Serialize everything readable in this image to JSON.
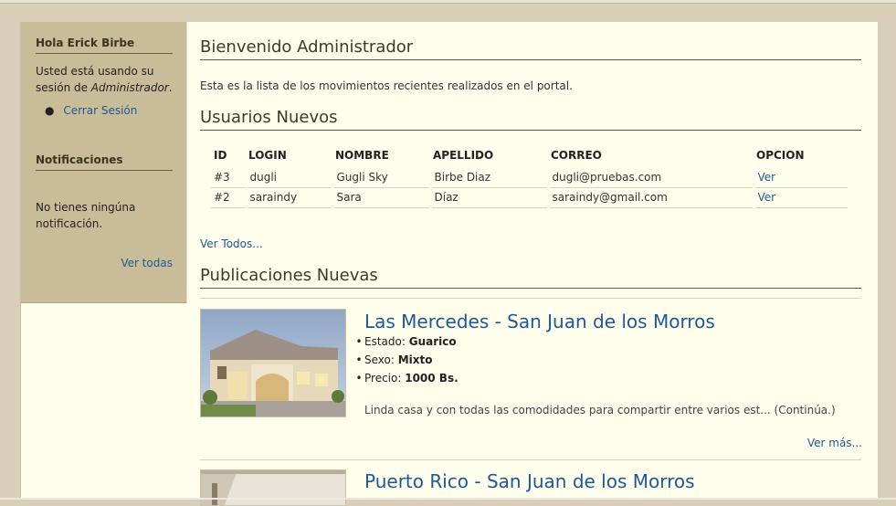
{
  "sidebar": {
    "greeting": "Hola Erick Birbe",
    "session_text_1": "Usted está usando su",
    "session_text_2_pre": "sesión de ",
    "session_role": "Administrador",
    "session_text_2_post": ".",
    "logout": "Cerrar Sesión",
    "notifications_title": "Notificaciones",
    "no_notifications_1": "No tienes ningúna",
    "no_notifications_2": "notificación.",
    "see_all": "Ver todas"
  },
  "main": {
    "welcome_title": "Bienvenido Administrador",
    "intro": "Esta es la lista de los movimientos recientes realizados en el portal.",
    "users_title": "Usuarios Nuevos",
    "users_headers": [
      "ID",
      "LOGIN",
      "NOMBRE",
      "APELLIDO",
      "CORREO",
      "OPCION"
    ],
    "users": [
      {
        "id": "#3",
        "login": "dugli",
        "nombre": "Gugli Sky",
        "apellido": "Birbe Diaz",
        "correo": "dugli@pruebas.com",
        "opcion": "Ver"
      },
      {
        "id": "#2",
        "login": "saraindy",
        "nombre": "Sara",
        "apellido": "Díaz",
        "correo": "saraindy@gmail.com",
        "opcion": "Ver"
      }
    ],
    "see_all_users": "Ver Todos...",
    "pubs_title": "Publicaciones Nuevas",
    "publications": [
      {
        "title": "Las Mercedes - San Juan de los Morros",
        "estado_label": "Estado: ",
        "estado": "Guarico",
        "sexo_label": "Sexo: ",
        "sexo": "Mixto",
        "precio_label": "Precio: ",
        "precio": "1000 Bs.",
        "description": "Linda casa y con todas las comodidades para compartir entre varios est... (Continúa.)",
        "more": "Ver más..."
      },
      {
        "title": "Puerto Rico - San Juan de los Morros"
      }
    ]
  },
  "colors": {
    "page_bg": "#d9cfb9",
    "content_bg": "#fffdeb",
    "sidebar_bg": "#c9bc98",
    "link": "#1d5a95"
  }
}
